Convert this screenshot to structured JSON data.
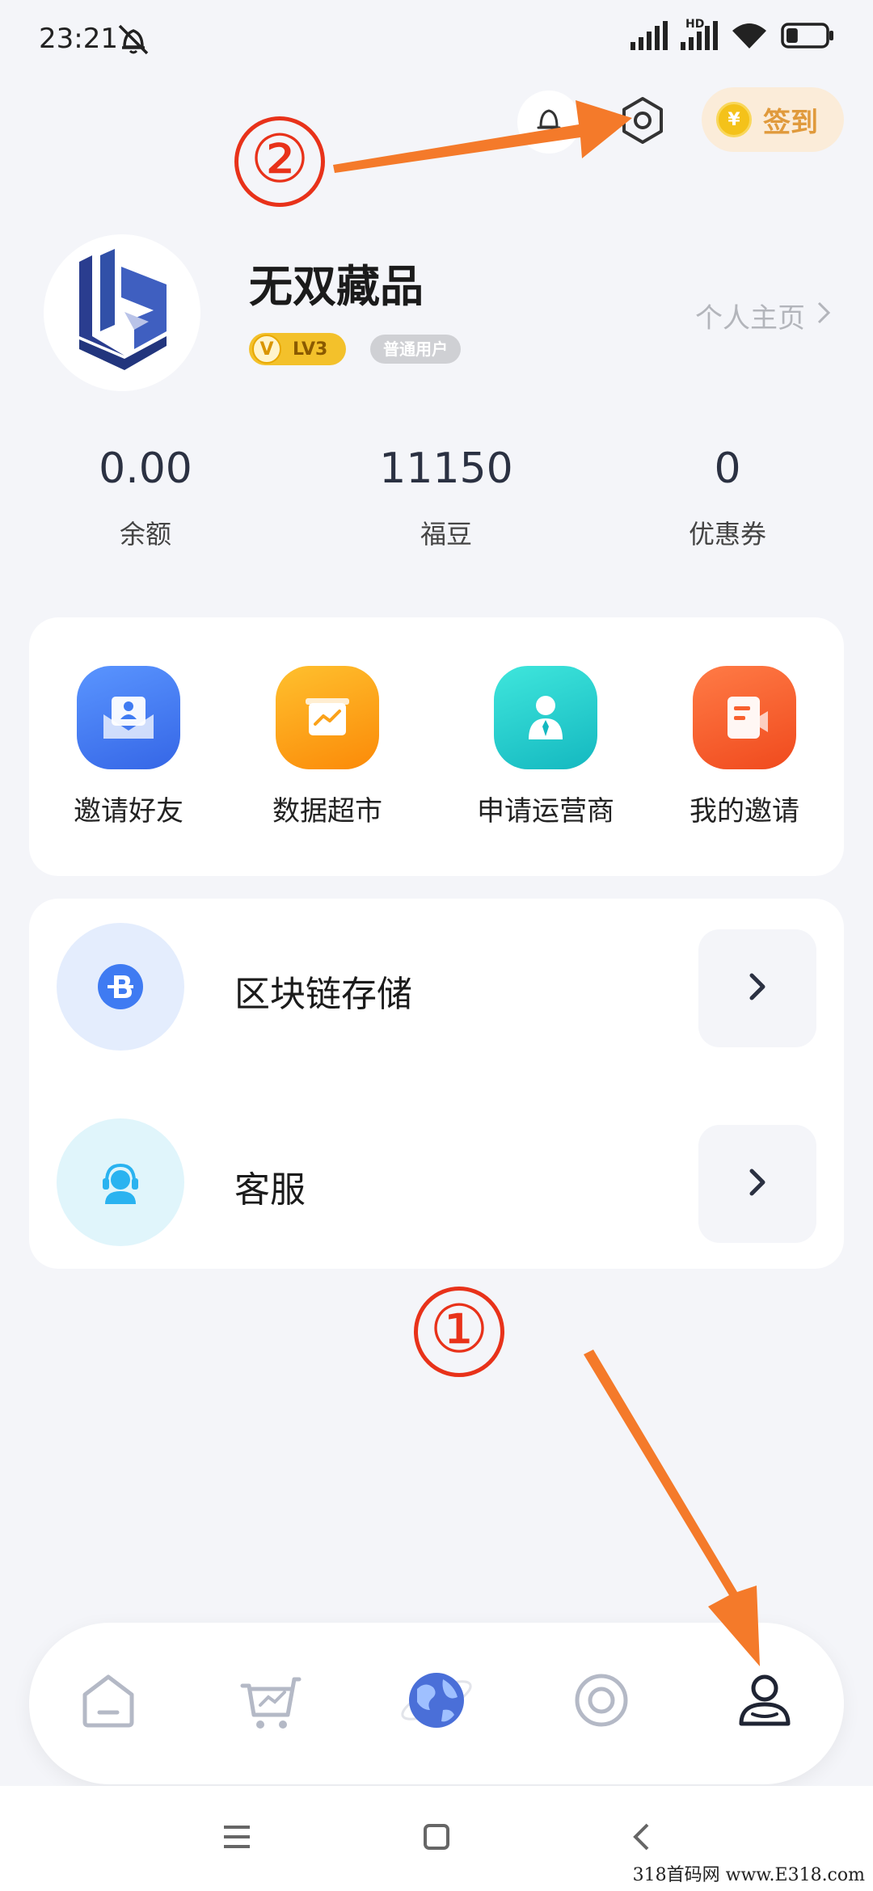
{
  "status_bar": {
    "time": "23:21",
    "network_label": "HD",
    "battery_level": 0.3
  },
  "top_actions": {
    "signin_label": "签到",
    "signin_coin_symbol": "¥"
  },
  "annotations": {
    "step_one": "①",
    "step_two": "②"
  },
  "profile": {
    "username": "无双藏品",
    "level_badge_icon": "V",
    "level": "LV3",
    "user_type": "普通用户",
    "homepage_link": "个人主页"
  },
  "stats": [
    {
      "value": "0.00",
      "label": "余额"
    },
    {
      "value": "11150",
      "label": "福豆"
    },
    {
      "value": "0",
      "label": "优惠券"
    }
  ],
  "shortcuts": [
    {
      "label": "邀请好友",
      "icon": "invite-card-icon",
      "color": "#3f7bf2"
    },
    {
      "label": "数据超市",
      "icon": "data-chart-icon",
      "color": "#fba21a"
    },
    {
      "label": "申请运营商",
      "icon": "operator-person-icon",
      "color": "#1ccfcb"
    },
    {
      "label": "我的邀请",
      "icon": "document-icon",
      "color": "#f8602e"
    }
  ],
  "menu_items": [
    {
      "label": "区块链存储",
      "icon": "blockchain-b-icon"
    },
    {
      "label": "客服",
      "icon": "customer-service-icon"
    }
  ],
  "tabbar": {
    "items": [
      "home-icon",
      "cart-chart-icon",
      "globe-icon",
      "discover-icon",
      "profile-icon"
    ],
    "active": "profile-icon"
  },
  "watermark": "318首码网 www.E318.com",
  "colors": {
    "background": "#f4f5f9",
    "annotation_red": "#e8321a",
    "arrow_orange": "#f47a2a",
    "signin_text": "#e09a3c"
  }
}
